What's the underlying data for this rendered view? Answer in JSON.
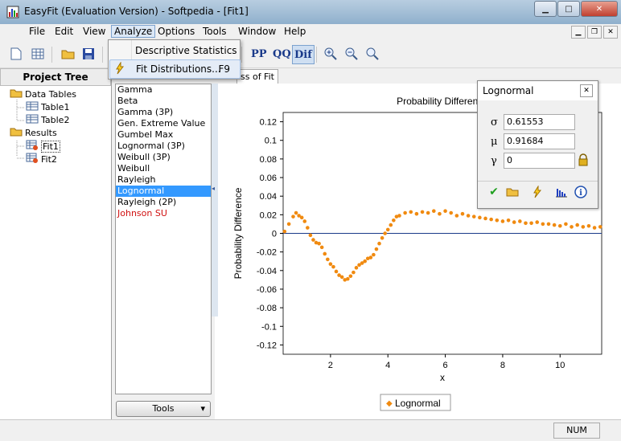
{
  "window": {
    "title": "EasyFit (Evaluation Version) - Softpedia - [Fit1]",
    "min_label": "▁",
    "max_label": "□",
    "close_label": "✕"
  },
  "menu": [
    "File",
    "Edit",
    "View",
    "Analyze",
    "Options",
    "Tools",
    "Window",
    "Help"
  ],
  "analyze_menu": [
    {
      "label": "Descriptive Statistics",
      "shortcut": ""
    },
    {
      "label": "Fit Distributions...",
      "shortcut": "F9"
    }
  ],
  "toolbar": {
    "pp": "PP",
    "qq": "QQ",
    "dif": "Dif"
  },
  "project": {
    "header": "Project Tree",
    "data_tables": "Data Tables",
    "table1": "Table1",
    "table2": "Table2",
    "results": "Results",
    "fit1": "Fit1",
    "fit2": "Fit2"
  },
  "distributions": [
    "Gamma",
    "Beta",
    "Gamma (3P)",
    "Gen. Extreme Value",
    "Gumbel Max",
    "Lognormal (3P)",
    "Weibull (3P)",
    "Weibull",
    "Rayleigh",
    "Lognormal",
    "Rayleigh (2P)",
    "Johnson SU"
  ],
  "selected_distribution": "Lognormal",
  "tools_button": "Tools",
  "tabs": {
    "goodness": "ss of Fit"
  },
  "param_window": {
    "title": "Lognormal",
    "sigma_symbol": "σ",
    "sigma": "0.61553",
    "mu_symbol": "μ",
    "mu": "0.91684",
    "gamma_symbol": "γ",
    "gamma": "0"
  },
  "status": {
    "num": "NUM"
  },
  "colors": {
    "series": "#f08a10",
    "zero_line": "#1a3a8a",
    "selection": "#3399ff"
  },
  "chart_data": {
    "type": "scatter",
    "title": "Probability Difference",
    "xlabel": "x",
    "ylabel": "Probability Difference",
    "xlim": [
      0.35,
      11.45
    ],
    "ylim": [
      -0.13,
      0.13
    ],
    "xticks": [
      2,
      4,
      6,
      8,
      10
    ],
    "yticks": [
      0.12,
      0.1,
      0.08,
      0.06,
      0.04,
      0.02,
      0,
      -0.02,
      -0.04,
      -0.06,
      -0.08,
      -0.1,
      -0.12
    ],
    "legend": {
      "position": "bottom-center",
      "label": "Lognormal"
    },
    "grid": false,
    "series": [
      {
        "name": "Lognormal",
        "x": [
          0.4,
          0.55,
          0.7,
          0.8,
          0.9,
          1.0,
          1.1,
          1.2,
          1.3,
          1.4,
          1.5,
          1.6,
          1.7,
          1.8,
          1.9,
          2.0,
          2.1,
          2.2,
          2.3,
          2.4,
          2.5,
          2.6,
          2.7,
          2.8,
          2.9,
          3.0,
          3.1,
          3.2,
          3.3,
          3.4,
          3.5,
          3.6,
          3.7,
          3.8,
          3.9,
          4.0,
          4.1,
          4.2,
          4.3,
          4.4,
          4.6,
          4.8,
          5.0,
          5.2,
          5.4,
          5.6,
          5.8,
          6.0,
          6.2,
          6.4,
          6.6,
          6.8,
          7.0,
          7.2,
          7.4,
          7.6,
          7.8,
          8.0,
          8.2,
          8.4,
          8.6,
          8.8,
          9.0,
          9.2,
          9.4,
          9.6,
          9.8,
          10.0,
          10.2,
          10.4,
          10.6,
          10.8,
          11.0,
          11.2,
          11.4
        ],
        "values": [
          0.002,
          0.01,
          0.018,
          0.022,
          0.019,
          0.017,
          0.013,
          0.006,
          -0.002,
          -0.007,
          -0.01,
          -0.011,
          -0.015,
          -0.022,
          -0.028,
          -0.033,
          -0.036,
          -0.041,
          -0.045,
          -0.047,
          -0.05,
          -0.049,
          -0.046,
          -0.042,
          -0.037,
          -0.034,
          -0.032,
          -0.03,
          -0.027,
          -0.026,
          -0.023,
          -0.017,
          -0.011,
          -0.005,
          0,
          0.004,
          0.009,
          0.014,
          0.018,
          0.019,
          0.022,
          0.023,
          0.021,
          0.023,
          0.022,
          0.024,
          0.021,
          0.024,
          0.022,
          0.019,
          0.021,
          0.019,
          0.018,
          0.017,
          0.016,
          0.015,
          0.014,
          0.013,
          0.014,
          0.012,
          0.013,
          0.011,
          0.011,
          0.012,
          0.01,
          0.01,
          0.009,
          0.008,
          0.01,
          0.007,
          0.009,
          0.007,
          0.008,
          0.006,
          0.007
        ]
      }
    ]
  }
}
